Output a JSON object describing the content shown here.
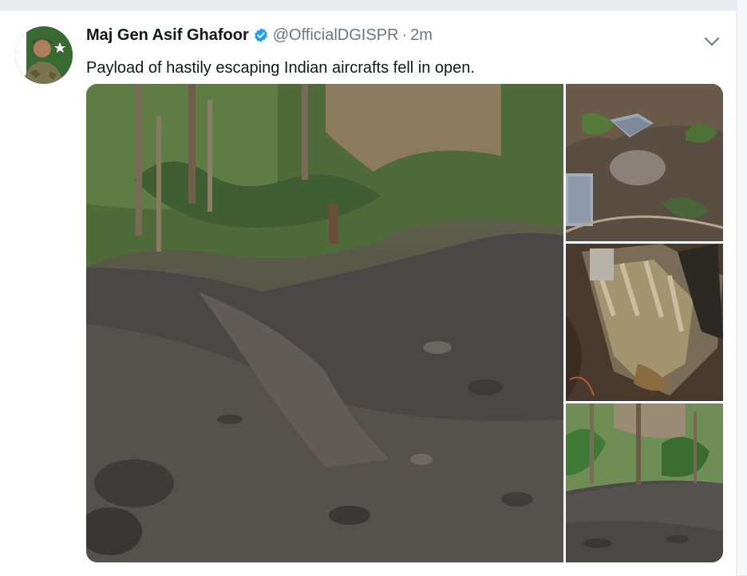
{
  "tweet": {
    "author_name": "Maj Gen Asif Ghafoor",
    "verified": true,
    "handle": "@OfficialDGISPR",
    "separator": "·",
    "time": "2m",
    "text": "Payload of hastily escaping Indian aircrafts fell in open.",
    "menu_icon": "chevron-down-icon",
    "verified_icon": "verified-badge-icon"
  },
  "media": {
    "photo_count": 4
  },
  "colors": {
    "text": "#14171a",
    "muted": "#657786",
    "verified_blue": "#1da1f2",
    "background": "#e6ecf0"
  }
}
